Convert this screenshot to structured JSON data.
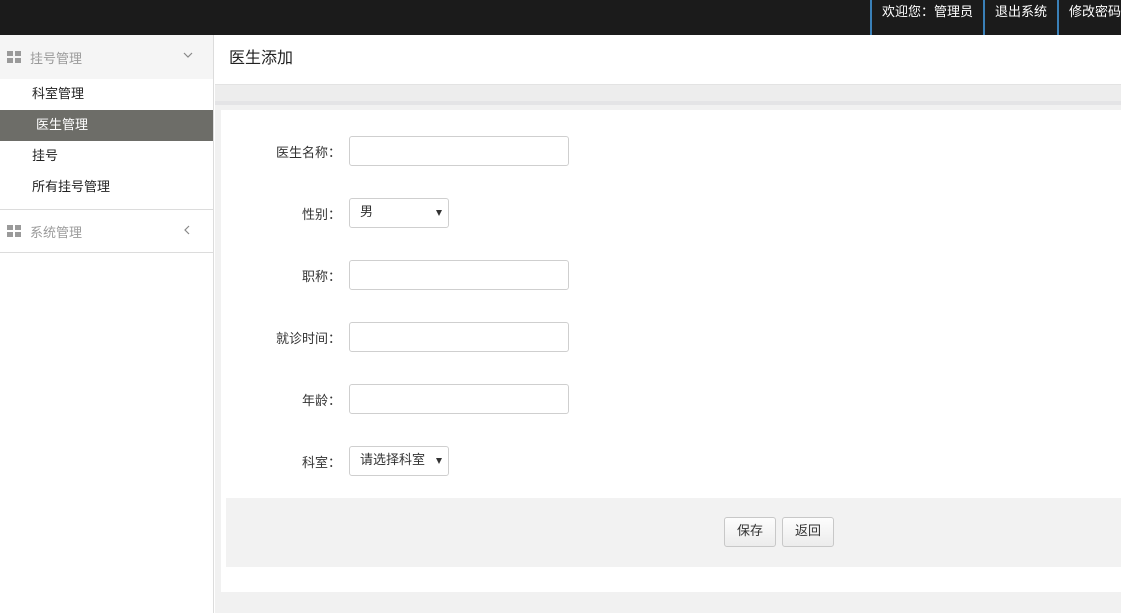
{
  "topbar": {
    "welcome": "欢迎您：管理员",
    "logout": "退出系统",
    "change_password": "修改密码"
  },
  "sidebar": {
    "groups": [
      {
        "title": "挂号管理",
        "expanded": true,
        "items": [
          {
            "label": "科室管理",
            "active": false
          },
          {
            "label": "医生管理",
            "active": true
          },
          {
            "label": "挂号",
            "active": false
          },
          {
            "label": "所有挂号管理",
            "active": false
          }
        ]
      },
      {
        "title": "系统管理",
        "expanded": false
      }
    ]
  },
  "page": {
    "title": "医生添加"
  },
  "form": {
    "fields": [
      {
        "label": "医生名称：",
        "type": "text",
        "value": ""
      },
      {
        "label": "性别：",
        "type": "select",
        "value": "男"
      },
      {
        "label": "职称：",
        "type": "text",
        "value": ""
      },
      {
        "label": "就诊时间：",
        "type": "text",
        "value": ""
      },
      {
        "label": "年龄：",
        "type": "text",
        "value": ""
      },
      {
        "label": "科室：",
        "type": "select",
        "value": "请选择科室"
      }
    ],
    "save_label": "保存",
    "back_label": "返回"
  },
  "colors": {
    "topbar_bg": "#1b1b1b",
    "topbar_divider": "#3a80b8",
    "active_menu_bg": "#6d6d68"
  }
}
